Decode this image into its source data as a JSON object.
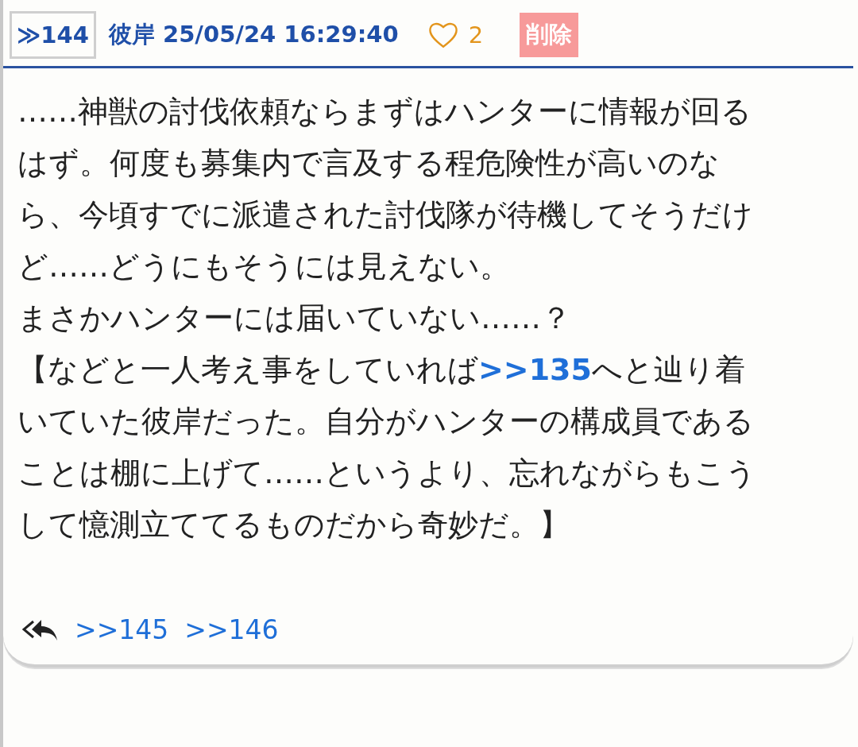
{
  "post": {
    "number": "≫144",
    "author": "彼岸",
    "timestamp": "25/05/24 16:29:40",
    "likes": "2",
    "delete_label": "削除",
    "body": [
      {
        "segments": [
          {
            "kind": "text",
            "text": "……神獣の討伐依頼ならまずはハンターに情報が回るはず。何度も募集内で言及する程危険性が高いのなら、今頃すでに派遣された討伐隊が待機してそうだけど……どうにもそうには見えない。"
          }
        ]
      },
      {
        "segments": [
          {
            "kind": "text",
            "text": "まさかハンターには届いていない……？"
          }
        ]
      },
      {
        "segments": [
          {
            "kind": "text",
            "text": "【などと一人考え事をしていれば"
          },
          {
            "kind": "link",
            "text": ">>135"
          },
          {
            "kind": "text",
            "text": "へと辿り着いていた彼岸だった。自分がハンターの構成員であることは棚に上げて……というより、忘れながらもこうして憶測立ててるものだから奇妙だ。】"
          }
        ]
      }
    ],
    "replies": [
      ">>145",
      ">>146"
    ]
  }
}
